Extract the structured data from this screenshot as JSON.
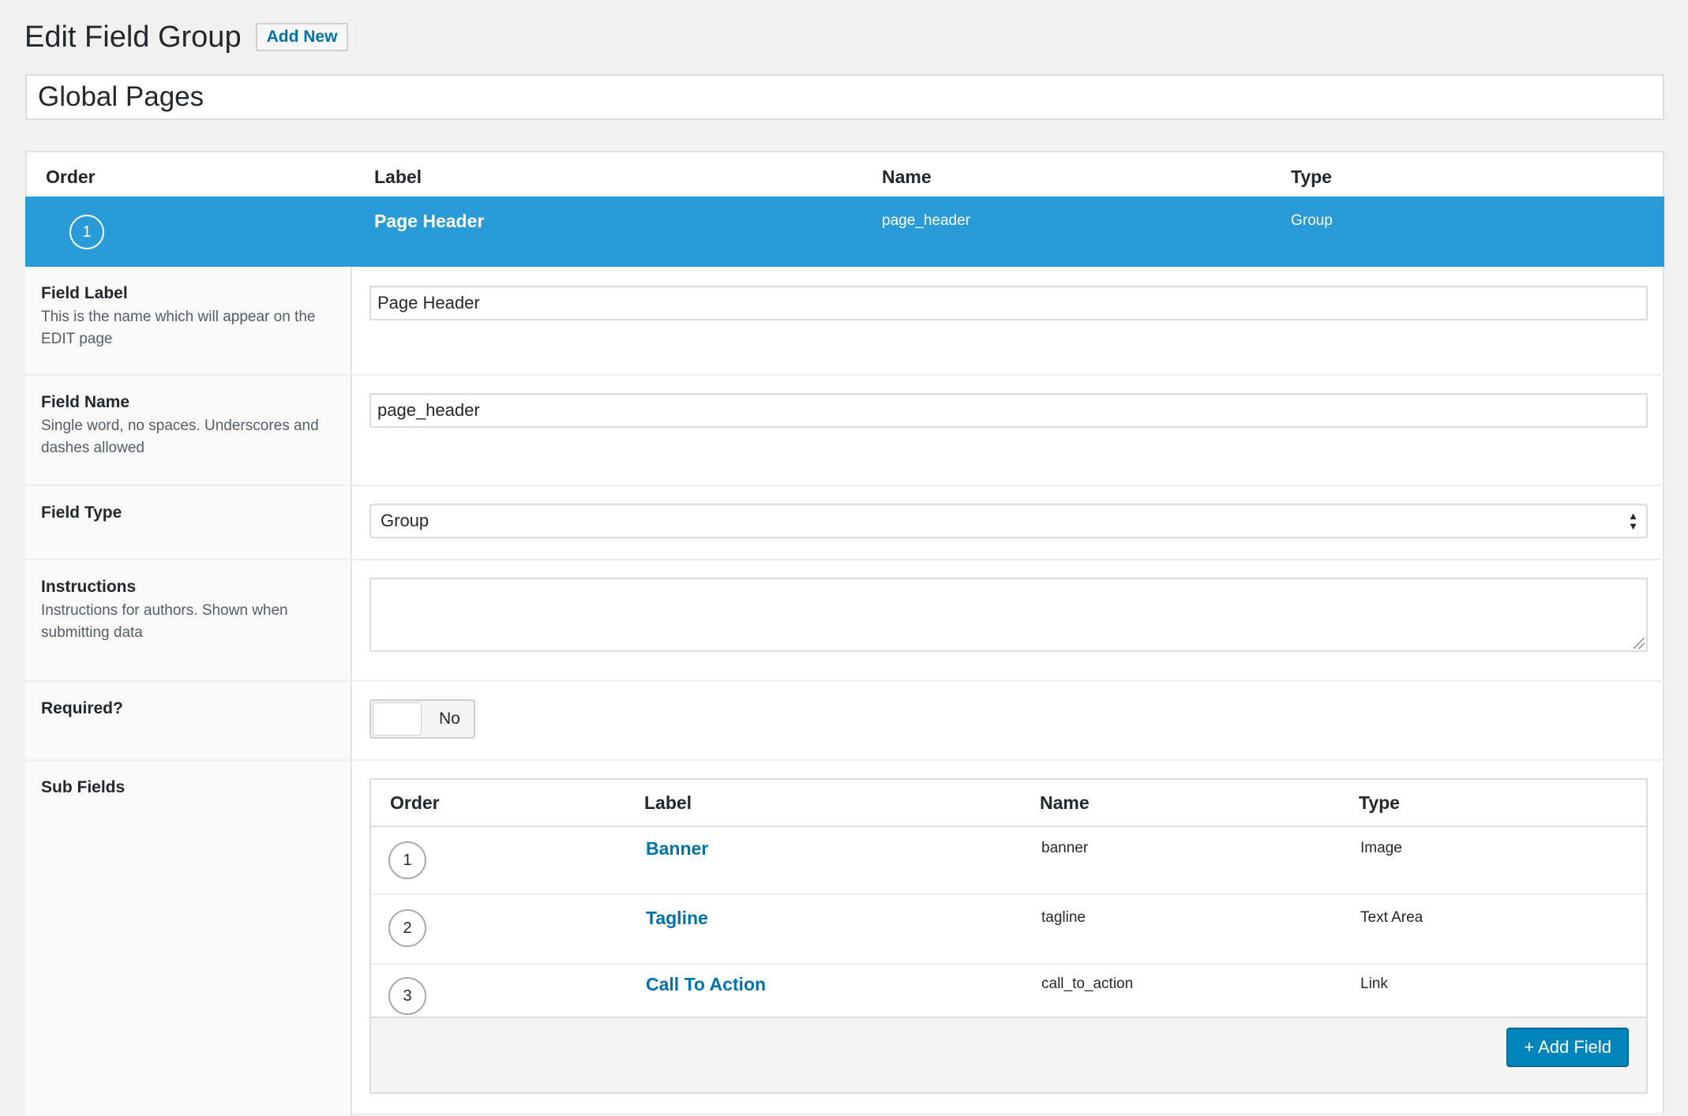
{
  "header": {
    "title": "Edit Field Group",
    "add_new_label": "Add New"
  },
  "group_title": "Global Pages",
  "fields_table": {
    "columns": [
      "Order",
      "Label",
      "Name",
      "Type"
    ],
    "active_field": {
      "order": "1",
      "label": "Page Header",
      "name": "page_header",
      "type": "Group"
    }
  },
  "settings": {
    "field_label": {
      "title": "Field Label",
      "description": "This is the name which will appear on the EDIT page",
      "value": "Page Header"
    },
    "field_name": {
      "title": "Field Name",
      "description": "Single word, no spaces. Underscores and dashes allowed",
      "value": "page_header"
    },
    "field_type": {
      "title": "Field Type",
      "value": "Group"
    },
    "instructions": {
      "title": "Instructions",
      "description": "Instructions for authors. Shown when submitting data",
      "value": ""
    },
    "required": {
      "title": "Required?",
      "value": "No"
    },
    "sub_fields": {
      "title": "Sub Fields",
      "columns": [
        "Order",
        "Label",
        "Name",
        "Type"
      ],
      "rows": [
        {
          "order": "1",
          "label": "Banner",
          "name": "banner",
          "type": "Image"
        },
        {
          "order": "2",
          "label": "Tagline",
          "name": "tagline",
          "type": "Text Area"
        },
        {
          "order": "3",
          "label": "Call To Action",
          "name": "call_to_action",
          "type": "Link"
        }
      ],
      "add_field_label": "+ Add Field"
    }
  },
  "colors": {
    "active_row": "#2a9bd9",
    "link": "#0073aa",
    "primary_button": "#0085ba"
  }
}
